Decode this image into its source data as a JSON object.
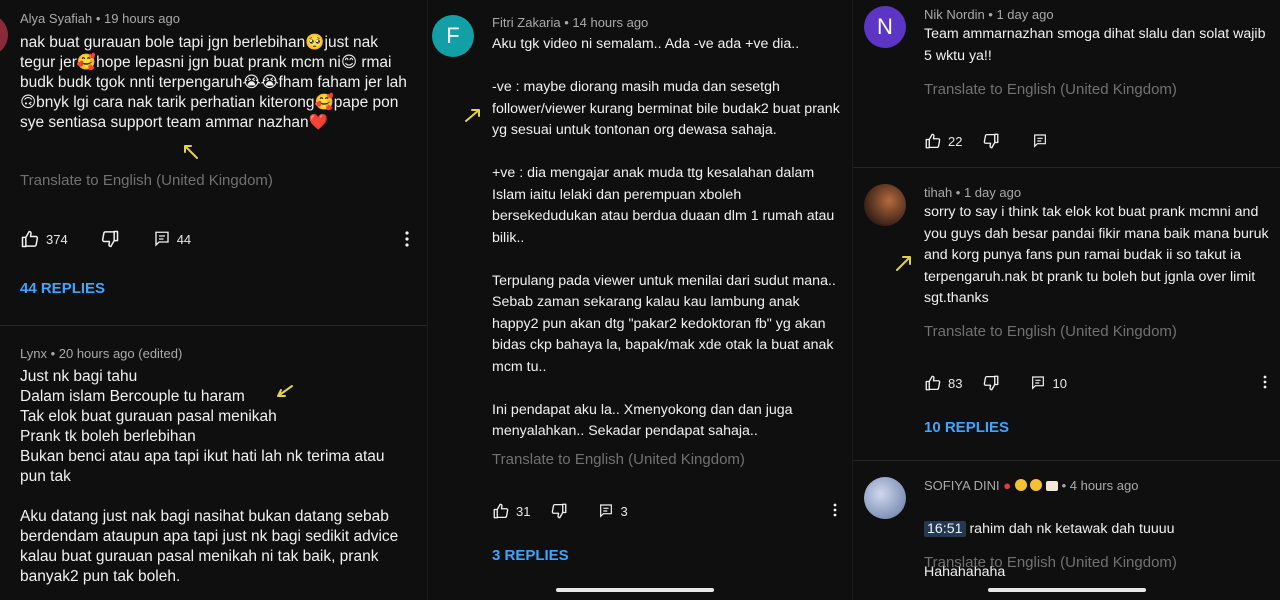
{
  "colors": {
    "background": "#0f0f0f",
    "text": "#f1f1f1",
    "meta": "#aaaaaa",
    "translate": "#717171",
    "link": "#3ea6ff",
    "arrow": "#e3d443"
  },
  "icons": {
    "like": "thumb-up-icon",
    "dislike": "thumb-down-icon",
    "reply": "comment-icon",
    "more": "three-dot-menu-icon"
  },
  "panel1": {
    "c1": {
      "author": "Alya Syafiah • 19 hours ago",
      "text": "nak buat gurauan bole tapi jgn berlebihan🥺just nak tegur jer🥰hope lepasni jgn buat prank mcm ni😊 rmai budk budk tgok nnti terpengaruh😭😭fham faham jer lah🙃bnyk lgi cara nak tarik perhatian kiterong🥰pape pon sye sentiasa support team ammar nazhan❤️",
      "translate": "Translate to English (United Kingdom)",
      "likes": "374",
      "replies_count": "44",
      "replies_link": "44 REPLIES"
    },
    "c2": {
      "author": "Lynx • 20 hours ago (edited)",
      "text": "Just nk bagi tahu\nDalam islam Bercouple tu haram\nTak elok buat gurauan pasal menikah\nPrank tk boleh berlebihan\nBukan benci atau apa tapi ikut hati lah nk terima atau pun tak\n\nAku datang just nak bagi nasihat bukan datang sebab berdendam ataupun apa tapi just nk bagi sedikit advice kalau buat gurauan pasal menikah ni tak baik, prank banyak2 pun tak boleh."
    }
  },
  "panel2": {
    "c1": {
      "avatar_letter": "F",
      "avatar_color": "#12a0a6",
      "author": "Fitri Zakaria • 14 hours ago",
      "text": "Aku tgk video ni semalam.. Ada -ve ada +ve dia..\n\n-ve : maybe diorang masih muda dan sesetgh follower/viewer  kurang berminat bile budak2 buat prank yg sesuai untuk tontonan org dewasa sahaja.\n\n+ve : dia mengajar anak muda ttg kesalahan dalam Islam iaitu lelaki dan perempuan xboleh bersekedudukan atau berdua duaan dlm 1 rumah atau bilik..\n\nTerpulang pada viewer untuk menilai dari sudut mana.. Sebab zaman sekarang kalau kau lambung anak happy2 pun akan dtg \"pakar2 kedoktoran fb\" yg akan bidas ckp bahaya la, bapak/mak xde otak la buat anak mcm tu..\n\nIni pendapat aku la.. Xmenyokong dan dan juga menyalahkan.. Sekadar pendapat sahaja..",
      "translate": "Translate to English (United Kingdom)",
      "likes": "31",
      "replies_count": "3",
      "replies_link": "3 REPLIES"
    }
  },
  "panel3": {
    "c1": {
      "avatar_letter": "N",
      "avatar_color": "#5c35c5",
      "author": "Nik Nordin • 1 day ago",
      "text": "Team ammarnazhan smoga dihat slalu dan solat wajib 5 wktu ya!!",
      "translate": "Translate to English (United Kingdom)",
      "likes": "22"
    },
    "c2": {
      "author": "tihah • 1 day ago",
      "text": "sorry to say i think tak elok kot buat prank mcmni and you guys dah besar pandai fikir mana baik mana buruk and korg punya fans pun ramai budak ii so takut ia terpengaruh.nak bt prank tu boleh but jgnla over limit sgt.thanks",
      "translate": "Translate to English (United Kingdom)",
      "likes": "83",
      "replies_count": "10",
      "replies_link": "10 REPLIES"
    },
    "c3": {
      "author_name": "SOFIYA DINI",
      "author_time": "• 4 hours ago",
      "timestamp": "16:51",
      "text_after": " rahim dah nk ketawak dah tuuuu",
      "text_line2": "Hahahahaha",
      "translate": "Translate to English (United Kingdom)"
    }
  }
}
